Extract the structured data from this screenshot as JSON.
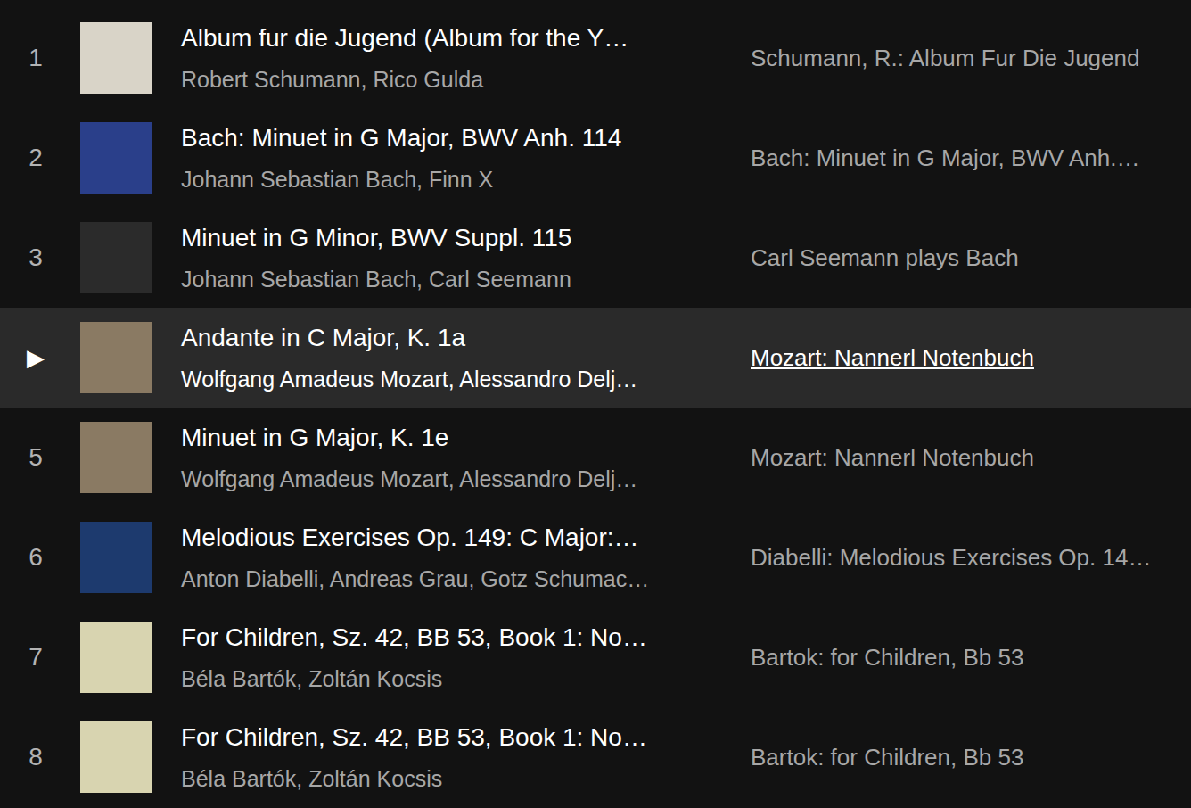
{
  "tracks": [
    {
      "number": "1",
      "title": "Album fur die Jugend (Album for the Y…",
      "artists": "Robert Schumann, Rico Gulda",
      "album": "Schumann, R.: Album Fur Die Jugend",
      "selected": false,
      "color": "#d9d4c8"
    },
    {
      "number": "2",
      "title": "Bach: Minuet in G Major, BWV Anh. 114",
      "artists": "Johann Sebastian Bach, Finn X",
      "album": "Bach: Minuet in G Major, BWV Anh.…",
      "selected": false,
      "color": "#2a3f8a"
    },
    {
      "number": "3",
      "title": "Minuet in G Minor, BWV Suppl. 115",
      "artists": "Johann Sebastian Bach, Carl Seemann",
      "album": "Carl Seemann plays Bach",
      "selected": false,
      "color": "#2b2b2b"
    },
    {
      "number": "▶",
      "title": "Andante in C Major, K. 1a",
      "artists": "Wolfgang Amadeus Mozart, Alessandro Delj…",
      "album": "Mozart: Nannerl Notenbuch",
      "selected": true,
      "color": "#8a7a63"
    },
    {
      "number": "5",
      "title": "Minuet in G Major, K. 1e",
      "artists": "Wolfgang Amadeus Mozart, Alessandro Delj…",
      "album": "Mozart: Nannerl Notenbuch",
      "selected": false,
      "color": "#8a7a63"
    },
    {
      "number": "6",
      "title": "Melodious Exercises Op. 149: C Major:…",
      "artists": "Anton Diabelli, Andreas Grau, Gotz Schumac…",
      "album": "Diabelli: Melodious Exercises Op. 14…",
      "selected": false,
      "color": "#1d3a6e"
    },
    {
      "number": "7",
      "title": "For Children, Sz. 42, BB 53, Book 1: No…",
      "artists": "Béla Bartók, Zoltán Kocsis",
      "album": "Bartok: for Children, Bb 53",
      "selected": false,
      "color": "#d8d4b0"
    },
    {
      "number": "8",
      "title": "For Children, Sz. 42, BB 53, Book 1: No…",
      "artists": "Béla Bartók, Zoltán Kocsis",
      "album": "Bartok: for Children, Bb 53",
      "selected": false,
      "color": "#d8d4b0"
    }
  ]
}
